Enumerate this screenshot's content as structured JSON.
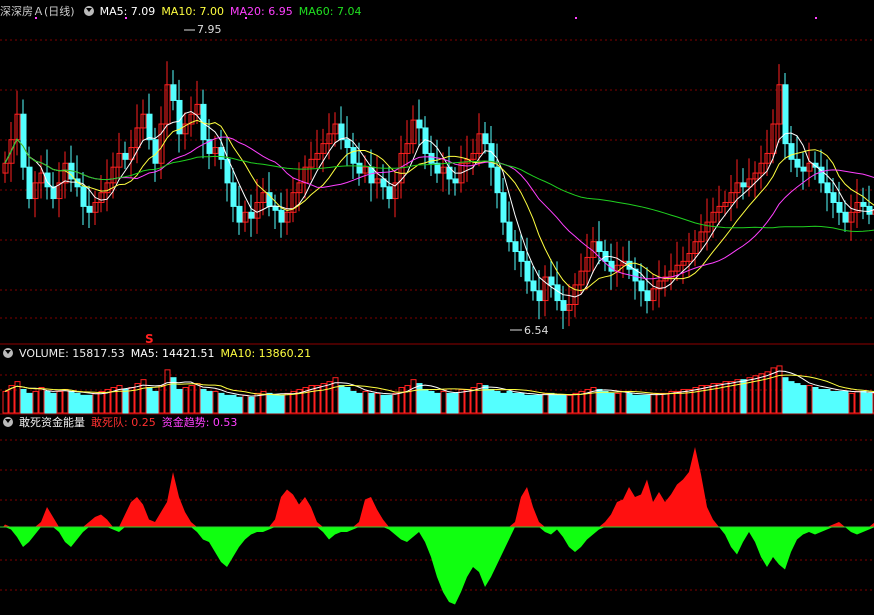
{
  "colors": {
    "up": "#ff2020",
    "down": "#54ffff",
    "ma5": "#ffffff",
    "ma10": "#ffff40",
    "ma20": "#ff40ff",
    "ma60": "#20d020",
    "pos": "#ff1010",
    "neg": "#10ff10",
    "grid": "#800000"
  },
  "price_header": {
    "title": "深深房Ａ(日线)",
    "ma5": "MA5: 7.09",
    "ma10": "MA10: 7.00",
    "ma20": "MA20: 6.95",
    "ma60": "MA60: 7.04"
  },
  "volume_header": {
    "volume": "VOLUME: 15817.53",
    "ma5": "MA5: 14421.51",
    "ma10": "MA10: 13860.21"
  },
  "fund_header": {
    "title": "敢死资金能量",
    "series1": "敢死队: 0.25",
    "series2": "资金趋势: 0.53"
  },
  "chart_data": [
    {
      "type": "candlestick",
      "title": "深深房Ａ(日线)",
      "annotations": {
        "high": "7.95",
        "low": "6.54",
        "signal": "S"
      },
      "ylim": [
        6.45,
        8.02
      ],
      "close": [
        7.3,
        7.42,
        7.55,
        7.28,
        7.12,
        7.2,
        7.25,
        7.18,
        7.12,
        7.2,
        7.3,
        7.22,
        7.18,
        7.08,
        7.05,
        7.1,
        7.15,
        7.2,
        7.28,
        7.35,
        7.32,
        7.38,
        7.48,
        7.55,
        7.42,
        7.3,
        7.5,
        7.7,
        7.62,
        7.45,
        7.5,
        7.55,
        7.6,
        7.42,
        7.35,
        7.38,
        7.32,
        7.2,
        7.08,
        7.0,
        7.05,
        7.02,
        7.1,
        7.15,
        7.08,
        7.06,
        7.0,
        7.05,
        7.15,
        7.2,
        7.28,
        7.32,
        7.35,
        7.4,
        7.45,
        7.5,
        7.42,
        7.38,
        7.3,
        7.25,
        7.28,
        7.2,
        7.22,
        7.18,
        7.12,
        7.2,
        7.35,
        7.4,
        7.52,
        7.48,
        7.35,
        7.3,
        7.25,
        7.28,
        7.22,
        7.2,
        7.3,
        7.32,
        7.35,
        7.45,
        7.4,
        7.28,
        7.15,
        7.0,
        6.9,
        6.85,
        6.8,
        6.7,
        6.65,
        6.6,
        6.72,
        6.68,
        6.6,
        6.55,
        6.58,
        6.68,
        6.75,
        6.82,
        6.9,
        6.85,
        6.8,
        6.75,
        6.78,
        6.8,
        6.76,
        6.7,
        6.65,
        6.6,
        6.66,
        6.7,
        6.72,
        6.75,
        6.78,
        6.8,
        6.84,
        6.9,
        6.95,
        7.0,
        7.05,
        7.08,
        7.1,
        7.15,
        7.2,
        7.18,
        7.22,
        7.25,
        7.3,
        7.35,
        7.5,
        7.7,
        7.4,
        7.32,
        7.28,
        7.26,
        7.3,
        7.28,
        7.2,
        7.15,
        7.1,
        7.05,
        7.0,
        7.05,
        7.1,
        7.08,
        7.04,
        7.06,
        7.05,
        7.08
      ],
      "high": "7.95",
      "low": "6.54"
    },
    {
      "type": "bar",
      "title": "VOLUME",
      "values": [
        11,
        14,
        16,
        12,
        10,
        11,
        13,
        11,
        10,
        11,
        12,
        11,
        10,
        9,
        9,
        10,
        11,
        12,
        13,
        14,
        12,
        13,
        15,
        17,
        13,
        11,
        14,
        22,
        18,
        12,
        13,
        14,
        15,
        12,
        11,
        11,
        10,
        9,
        9,
        8,
        9,
        8,
        10,
        11,
        10,
        9,
        9,
        10,
        11,
        12,
        13,
        14,
        14,
        15,
        16,
        18,
        14,
        13,
        11,
        10,
        11,
        10,
        10,
        9,
        9,
        10,
        13,
        14,
        17,
        15,
        12,
        11,
        10,
        11,
        10,
        10,
        12,
        12,
        13,
        15,
        14,
        12,
        11,
        10,
        11,
        10,
        10,
        9,
        9,
        9,
        10,
        10,
        9,
        9,
        9,
        10,
        11,
        12,
        13,
        12,
        11,
        10,
        10,
        11,
        10,
        9,
        9,
        9,
        10,
        10,
        10,
        11,
        11,
        12,
        12,
        13,
        14,
        14,
        15,
        15,
        16,
        16,
        17,
        17,
        18,
        19,
        20,
        21,
        23,
        24,
        18,
        16,
        15,
        14,
        14,
        13,
        12,
        12,
        11,
        11,
        11,
        10,
        11,
        11,
        10,
        10,
        10,
        11
      ],
      "ma5": "14421.51",
      "ma10": "13860.21"
    },
    {
      "type": "area",
      "title": "敢死资金能量",
      "series": [
        {
          "name": "敢死队",
          "values": [
            0.1,
            -0.1,
            -0.4,
            -0.8,
            -0.6,
            -0.3,
            0.2,
            0.8,
            0.4,
            -0.2,
            -0.6,
            -0.8,
            -0.5,
            -0.2,
            0.2,
            0.4,
            0.5,
            0.3,
            -0.1,
            -0.2,
            0.5,
            1.0,
            1.2,
            0.9,
            0.3,
            0.2,
            0.6,
            1.0,
            2.2,
            1.2,
            0.6,
            0.2,
            -0.2,
            -0.5,
            -0.6,
            -1.0,
            -1.4,
            -1.6,
            -1.2,
            -0.8,
            -0.5,
            -0.3,
            -0.2,
            -0.2,
            -0.1,
            0.3,
            1.2,
            1.5,
            1.3,
            0.9,
            1.2,
            0.8,
            0.2,
            -0.2,
            -0.5,
            -0.3,
            -0.2,
            -0.2,
            -0.1,
            0.2,
            1.1,
            1.2,
            0.7,
            0.3,
            -0.1,
            -0.3,
            -0.5,
            -0.6,
            -0.4,
            -0.2,
            -0.6,
            -1.2,
            -2.0,
            -2.6,
            -3.0,
            -3.1,
            -2.6,
            -2.0,
            -1.6,
            -1.8,
            -2.4,
            -2.0,
            -1.5,
            -1.0,
            -0.5,
            0.2,
            1.2,
            1.6,
            0.8,
            0.2,
            -0.2,
            -0.3,
            -0.1,
            -0.4,
            -0.8,
            -1.0,
            -0.8,
            -0.5,
            -0.3,
            -0.1,
            0.2,
            0.5,
            1.0,
            1.1,
            1.6,
            1.2,
            1.3,
            1.9,
            1.0,
            1.4,
            1.0,
            1.3,
            1.7,
            1.9,
            2.2,
            3.2,
            2.1,
            0.8,
            0.3,
            0.0,
            -0.3,
            -0.8,
            -1.1,
            -0.6,
            -0.2,
            -0.6,
            -1.2,
            -1.6,
            -1.2,
            -1.5,
            -1.7,
            -1.0,
            -0.5,
            -0.3,
            -0.2,
            -0.3,
            -0.2,
            -0.1,
            0.1,
            0.2,
            0.0,
            -0.2,
            -0.3,
            -0.2,
            -0.1,
            0.2,
            0.25
          ]
        },
        {
          "name": "资金趋势",
          "value": "0.53"
        }
      ],
      "ylim": [
        -3.4,
        3.4
      ]
    }
  ]
}
